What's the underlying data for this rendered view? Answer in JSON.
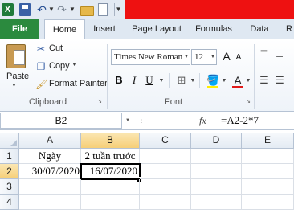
{
  "qat": {
    "logo": "X"
  },
  "tabs": [
    "File",
    "Home",
    "Insert",
    "Page Layout",
    "Formulas",
    "Data",
    "R"
  ],
  "clipboard": {
    "paste": "Paste",
    "cut": "Cut",
    "copy": "Copy",
    "format_painter": "Format Painter",
    "label": "Clipboard"
  },
  "font": {
    "name": "Times New Roman",
    "size": "12",
    "label": "Font",
    "bold": "B",
    "italic": "I",
    "underline": "U",
    "grow": "A",
    "shrink": "A",
    "font_color_letter": "A",
    "font_color": "#e01a1a",
    "fill_color": "#ffee00"
  },
  "formula_bar": {
    "name_box": "B2",
    "fx": "fx",
    "formula": "=A2-2*7"
  },
  "grid": {
    "columns": [
      "A",
      "B",
      "C",
      "D",
      "E"
    ],
    "rows": [
      "1",
      "2",
      "3",
      "4"
    ],
    "cells": {
      "A1": "Ngày",
      "B1": "2 tuần trước",
      "A2": "30/07/2020",
      "B2": "16/07/2020"
    },
    "active_cell": "B2"
  }
}
